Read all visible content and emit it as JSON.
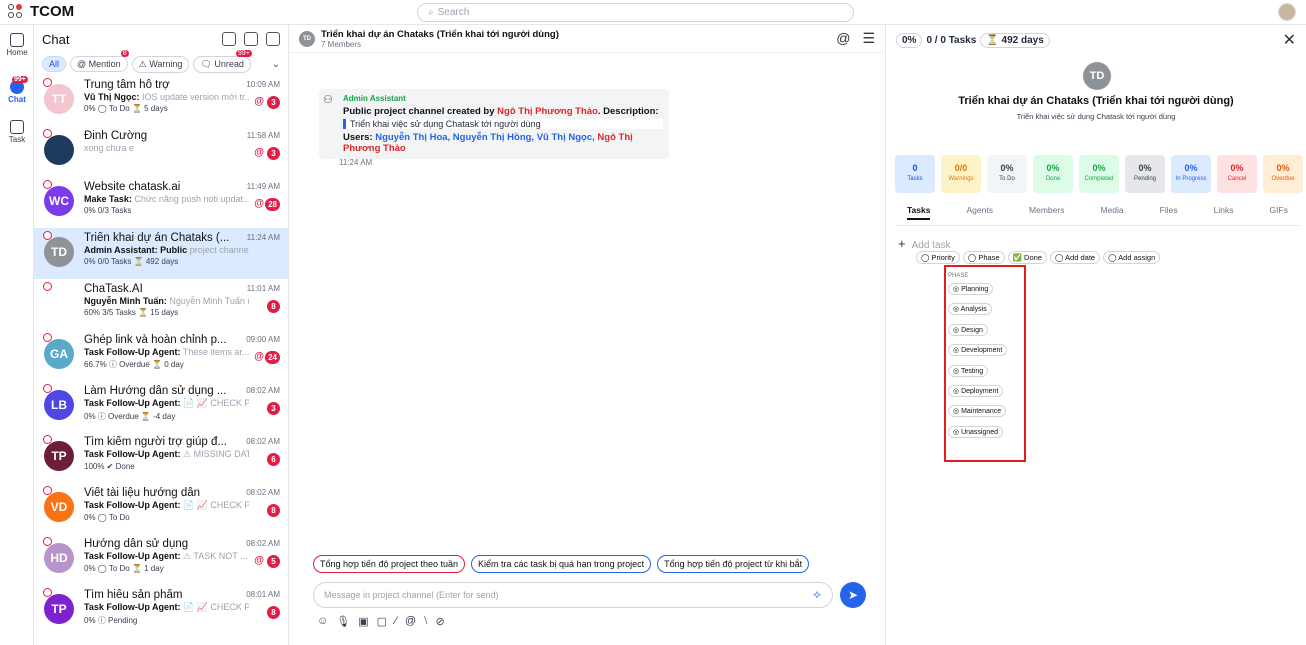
{
  "app": {
    "name": "TCOM"
  },
  "search": {
    "placeholder": "Search"
  },
  "nav": {
    "home": "Home",
    "chat": "Chat",
    "chat_badge": "99+",
    "task": "Task"
  },
  "chat_list": {
    "title": "Chat",
    "filters": {
      "all": "All",
      "mention": "@ Mention",
      "mention_badge": "8",
      "warning": "Warning",
      "unread": "Unread",
      "unread_badge": "99+"
    },
    "conversations": [
      {
        "initials": "TT",
        "color": "#f3c6cf",
        "title": "Trung tâm hỗ trợ",
        "time": "10:09 AM",
        "sender": "Vũ Thị Ngọc:",
        "preview": "IOS update version mới tr...",
        "meta": "0%  ◯ To Do  ⏳ 5 days",
        "badge": "3",
        "mention": "@"
      },
      {
        "initials": "",
        "color": "#1e3a5f",
        "title": "Đinh Cường",
        "time": "11:58 AM",
        "sender": "",
        "preview": "xong chưa e",
        "meta": "",
        "badge": "3",
        "mention": "@"
      },
      {
        "initials": "WC",
        "color": "#7c3aed",
        "title": "Website chatask.ai",
        "time": "11:49 AM",
        "sender": "Make Task:",
        "preview": "Chức năng push noti updat...",
        "meta": "0%  0/3 Tasks",
        "badge": "28",
        "mention": "@"
      },
      {
        "initials": "TD",
        "color": "#8e9398",
        "title": "Triển khai dự án Chataks (...",
        "time": "11:24 AM",
        "sender": "Admin Assistant: Public",
        "preview": "project channel creat...",
        "meta": "0%  0/0 Tasks  ⏳ 492 days",
        "badge": "",
        "mention": ""
      },
      {
        "initials": "",
        "color": "#ffffff",
        "title": "ChaTask.AI",
        "time": "11:01 AM",
        "sender": "Nguyễn Minh Tuấn:",
        "preview": "Nguyễn Minh Tuấn up...",
        "meta": "60%  3/5 Tasks  ⏳ 15 days",
        "badge": "8",
        "mention": ""
      },
      {
        "initials": "GA",
        "color": "#5aa9c9",
        "title": "Ghép link và hoàn chỉnh p...",
        "time": "09:00 AM",
        "sender": "Task Follow-Up Agent:",
        "preview": "These items ar...",
        "meta": "66.7%  ⓘ Overdue  ⏳ 0 day",
        "badge": "24",
        "mention": "@"
      },
      {
        "initials": "LB",
        "color": "#4f46e5",
        "title": "Làm Hướng dẫn sử dụng ...",
        "time": "08:02 AM",
        "sender": "Task Follow-Up Agent:",
        "preview": "📄 📈 CHECK PR...",
        "meta": "0%  ⓘ Overdue  ⏳ -4 day",
        "badge": "3",
        "mention": ""
      },
      {
        "initials": "TP",
        "color": "#6b1d3a",
        "title": "Tìm kiếm người trợ giúp đ...",
        "time": "08:02 AM",
        "sender": "Task Follow-Up Agent:",
        "preview": "⚠ MISSING DAT...",
        "meta": "100%  ✔ Done",
        "badge": "6",
        "mention": ""
      },
      {
        "initials": "VD",
        "color": "#f97316",
        "title": "Viết tài liệu hướng dẫn",
        "time": "08:02 AM",
        "sender": "Task Follow-Up Agent:",
        "preview": "📄 📈 CHECK PR...",
        "meta": "0%  ◯ To Do",
        "badge": "8",
        "mention": ""
      },
      {
        "initials": "HD",
        "color": "#b794c9",
        "title": "Hướng dẫn sử dụng",
        "time": "08:02 AM",
        "sender": "Task Follow-Up Agent:",
        "preview": "⚠ TASK NOT ...",
        "meta": "0%  ◯ To Do  ⏳ 1 day",
        "badge": "5",
        "mention": "@"
      },
      {
        "initials": "TP",
        "color": "#7e22ce",
        "title": "Tìm hiểu sản phẩm",
        "time": "08:01 AM",
        "sender": "Task Follow-Up Agent:",
        "preview": "📄 📈 CHECK PR...",
        "meta": "0%  ⓘ Pending",
        "badge": "8",
        "mention": ""
      }
    ]
  },
  "channel": {
    "initials": "TD",
    "title": "Triển khai dự án Chataks (Triển khai tới người dùng)",
    "members": "7 Members",
    "message": {
      "author": "Admin Assistant",
      "line1_a": "Public project channel created by ",
      "line1_name": "Ngô Thị Phương Thảo",
      "line1_b": ". Description:",
      "quote": "Triển khai việc sử dụng Chatask tới người dùng",
      "users_label": "Users: ",
      "users_blue": "Nguyễn Thị Hoa, Nguyễn Thị Hồng, Vũ Thị Ngọc, ",
      "users_red": "Ngô Thị Phương Thảo",
      "time": "11:24 AM"
    },
    "suggestions": [
      "Tổng hợp tiến độ project theo tuần",
      "Kiểm tra các task bị quá hạn trong project",
      "Tổng hợp tiến độ project từ khi bắt"
    ],
    "input_placeholder": "Message in project channel (Enter for send)"
  },
  "panel": {
    "percent": "0%",
    "tasks_summary": "0 / 0 Tasks",
    "days": "⏳ 492 days",
    "initials": "TD",
    "title": "Triển khai dự án Chataks (Triển khai tới người dùng)",
    "description": "Triển khai việc sử dụng Chatask tới người dùng",
    "stats": [
      {
        "value": "0",
        "label": "Tasks",
        "bg": "#dbeafe",
        "fg": "#1d4ed8"
      },
      {
        "value": "0/0",
        "label": "Warnings",
        "bg": "#fef3c7",
        "fg": "#d97706"
      },
      {
        "value": "0%",
        "label": "To Do",
        "bg": "#f3f4f6",
        "fg": "#374151"
      },
      {
        "value": "0%",
        "label": "Done",
        "bg": "#dcfce7",
        "fg": "#16a34a"
      },
      {
        "value": "0%",
        "label": "Completed",
        "bg": "#dcfce7",
        "fg": "#16a34a"
      },
      {
        "value": "0%",
        "label": "Pending",
        "bg": "#e5e7eb",
        "fg": "#374151"
      },
      {
        "value": "0%",
        "label": "In Progress",
        "bg": "#dbeafe",
        "fg": "#2563eb"
      },
      {
        "value": "0%",
        "label": "Cancel",
        "bg": "#fee2e2",
        "fg": "#dc2626"
      },
      {
        "value": "0%",
        "label": "Overdue",
        "bg": "#ffedd5",
        "fg": "#ea580c"
      }
    ],
    "tabs": [
      "Tasks",
      "Agents",
      "Members",
      "Media",
      "Files",
      "Links",
      "GIFs"
    ],
    "add_task": "Add task",
    "task_options": [
      "Priority",
      "Phase",
      "Done",
      "Add date",
      "Add assign"
    ],
    "phase_header": "PHASE",
    "phases": [
      "Planning",
      "Analysis",
      "Design",
      "Development",
      "Testing",
      "Deployment",
      "Maintenance",
      "Unassigned"
    ]
  }
}
